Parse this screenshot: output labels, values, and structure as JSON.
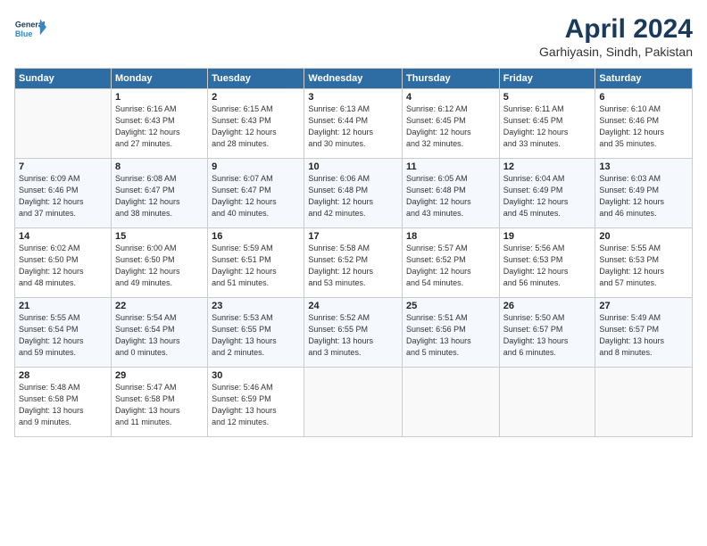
{
  "logo": {
    "line1": "General",
    "line2": "Blue"
  },
  "title": "April 2024",
  "location": "Garhiyasin, Sindh, Pakistan",
  "headers": [
    "Sunday",
    "Monday",
    "Tuesday",
    "Wednesday",
    "Thursday",
    "Friday",
    "Saturday"
  ],
  "weeks": [
    [
      {
        "day": "",
        "info": ""
      },
      {
        "day": "1",
        "info": "Sunrise: 6:16 AM\nSunset: 6:43 PM\nDaylight: 12 hours\nand 27 minutes."
      },
      {
        "day": "2",
        "info": "Sunrise: 6:15 AM\nSunset: 6:43 PM\nDaylight: 12 hours\nand 28 minutes."
      },
      {
        "day": "3",
        "info": "Sunrise: 6:13 AM\nSunset: 6:44 PM\nDaylight: 12 hours\nand 30 minutes."
      },
      {
        "day": "4",
        "info": "Sunrise: 6:12 AM\nSunset: 6:45 PM\nDaylight: 12 hours\nand 32 minutes."
      },
      {
        "day": "5",
        "info": "Sunrise: 6:11 AM\nSunset: 6:45 PM\nDaylight: 12 hours\nand 33 minutes."
      },
      {
        "day": "6",
        "info": "Sunrise: 6:10 AM\nSunset: 6:46 PM\nDaylight: 12 hours\nand 35 minutes."
      }
    ],
    [
      {
        "day": "7",
        "info": "Sunrise: 6:09 AM\nSunset: 6:46 PM\nDaylight: 12 hours\nand 37 minutes."
      },
      {
        "day": "8",
        "info": "Sunrise: 6:08 AM\nSunset: 6:47 PM\nDaylight: 12 hours\nand 38 minutes."
      },
      {
        "day": "9",
        "info": "Sunrise: 6:07 AM\nSunset: 6:47 PM\nDaylight: 12 hours\nand 40 minutes."
      },
      {
        "day": "10",
        "info": "Sunrise: 6:06 AM\nSunset: 6:48 PM\nDaylight: 12 hours\nand 42 minutes."
      },
      {
        "day": "11",
        "info": "Sunrise: 6:05 AM\nSunset: 6:48 PM\nDaylight: 12 hours\nand 43 minutes."
      },
      {
        "day": "12",
        "info": "Sunrise: 6:04 AM\nSunset: 6:49 PM\nDaylight: 12 hours\nand 45 minutes."
      },
      {
        "day": "13",
        "info": "Sunrise: 6:03 AM\nSunset: 6:49 PM\nDaylight: 12 hours\nand 46 minutes."
      }
    ],
    [
      {
        "day": "14",
        "info": "Sunrise: 6:02 AM\nSunset: 6:50 PM\nDaylight: 12 hours\nand 48 minutes."
      },
      {
        "day": "15",
        "info": "Sunrise: 6:00 AM\nSunset: 6:50 PM\nDaylight: 12 hours\nand 49 minutes."
      },
      {
        "day": "16",
        "info": "Sunrise: 5:59 AM\nSunset: 6:51 PM\nDaylight: 12 hours\nand 51 minutes."
      },
      {
        "day": "17",
        "info": "Sunrise: 5:58 AM\nSunset: 6:52 PM\nDaylight: 12 hours\nand 53 minutes."
      },
      {
        "day": "18",
        "info": "Sunrise: 5:57 AM\nSunset: 6:52 PM\nDaylight: 12 hours\nand 54 minutes."
      },
      {
        "day": "19",
        "info": "Sunrise: 5:56 AM\nSunset: 6:53 PM\nDaylight: 12 hours\nand 56 minutes."
      },
      {
        "day": "20",
        "info": "Sunrise: 5:55 AM\nSunset: 6:53 PM\nDaylight: 12 hours\nand 57 minutes."
      }
    ],
    [
      {
        "day": "21",
        "info": "Sunrise: 5:55 AM\nSunset: 6:54 PM\nDaylight: 12 hours\nand 59 minutes."
      },
      {
        "day": "22",
        "info": "Sunrise: 5:54 AM\nSunset: 6:54 PM\nDaylight: 13 hours\nand 0 minutes."
      },
      {
        "day": "23",
        "info": "Sunrise: 5:53 AM\nSunset: 6:55 PM\nDaylight: 13 hours\nand 2 minutes."
      },
      {
        "day": "24",
        "info": "Sunrise: 5:52 AM\nSunset: 6:55 PM\nDaylight: 13 hours\nand 3 minutes."
      },
      {
        "day": "25",
        "info": "Sunrise: 5:51 AM\nSunset: 6:56 PM\nDaylight: 13 hours\nand 5 minutes."
      },
      {
        "day": "26",
        "info": "Sunrise: 5:50 AM\nSunset: 6:57 PM\nDaylight: 13 hours\nand 6 minutes."
      },
      {
        "day": "27",
        "info": "Sunrise: 5:49 AM\nSunset: 6:57 PM\nDaylight: 13 hours\nand 8 minutes."
      }
    ],
    [
      {
        "day": "28",
        "info": "Sunrise: 5:48 AM\nSunset: 6:58 PM\nDaylight: 13 hours\nand 9 minutes."
      },
      {
        "day": "29",
        "info": "Sunrise: 5:47 AM\nSunset: 6:58 PM\nDaylight: 13 hours\nand 11 minutes."
      },
      {
        "day": "30",
        "info": "Sunrise: 5:46 AM\nSunset: 6:59 PM\nDaylight: 13 hours\nand 12 minutes."
      },
      {
        "day": "",
        "info": ""
      },
      {
        "day": "",
        "info": ""
      },
      {
        "day": "",
        "info": ""
      },
      {
        "day": "",
        "info": ""
      }
    ]
  ]
}
